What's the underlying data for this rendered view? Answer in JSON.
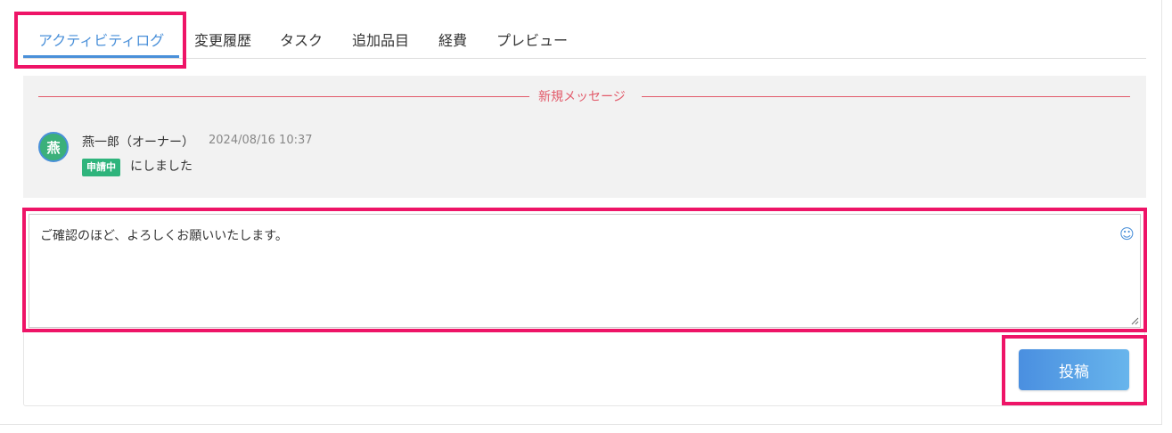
{
  "tabs": [
    {
      "label": "アクティビティログ",
      "active": true
    },
    {
      "label": "変更履歴",
      "active": false
    },
    {
      "label": "タスク",
      "active": false
    },
    {
      "label": "追加品目",
      "active": false
    },
    {
      "label": "経費",
      "active": false
    },
    {
      "label": "プレビュー",
      "active": false
    }
  ],
  "activity": {
    "divider_label": "新規メッセージ",
    "entry": {
      "avatar_text": "燕",
      "author": "燕一郎（オーナー）",
      "timestamp": "2024/08/16 10:37",
      "status_badge": "申請中",
      "status_text": "にしました"
    }
  },
  "comment": {
    "value": "ご確認のほど、よろしくお願いいたします。",
    "emoji_icon": "smiley-icon"
  },
  "actions": {
    "post_label": "投稿"
  },
  "colors": {
    "accent": "#4a90d9",
    "highlight": "#ee1467",
    "divider": "#e25a6a",
    "badge": "#2fb47c",
    "activity_bg": "#f2f2f2"
  }
}
